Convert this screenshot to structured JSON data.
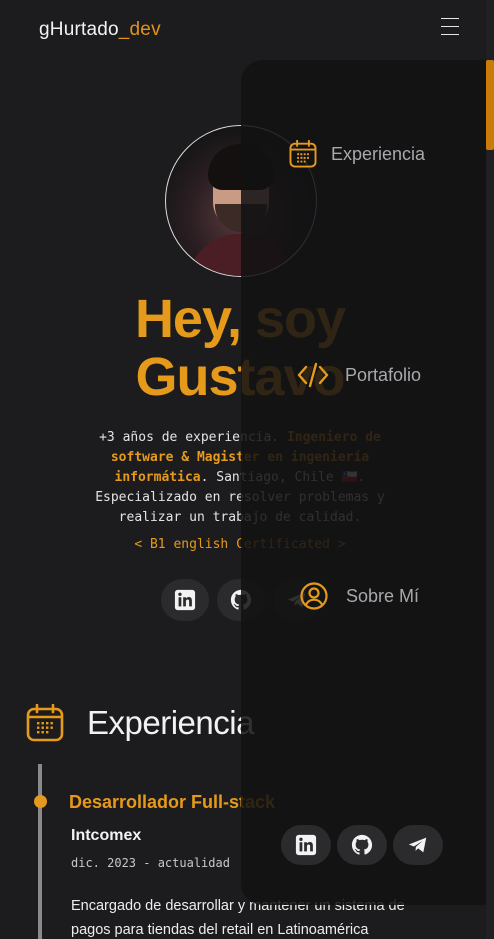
{
  "header": {
    "brand_main": "gHurtado",
    "brand_accent": "_dev",
    "menu_icon": "hamburger-icon"
  },
  "hero": {
    "title_line1": "Hey, soy",
    "title_line2": "Gustavo",
    "desc_part1": "+3 años de experiencia. ",
    "desc_highlight1": "Ingeniero de software & Magister en ingeniería informática",
    "desc_part2": ". Santiago, Chile 🇨🇱. Especializado en resolver problemas y realizar un trabajo de calidad.",
    "certificate": "< B1 english Certificated >",
    "socials": [
      "linkedin-icon",
      "github-icon",
      "telegram-icon"
    ]
  },
  "experience": {
    "section_title": "Experiencia",
    "section_icon": "calendar-icon",
    "jobs": [
      {
        "role": "Desarrollador Full-stack",
        "company": "Intcomex",
        "date": "dic. 2023 - actualidad",
        "description": "Encargado de desarrollar y mantener un sistema de pagos para tiendas del retail en Latinoamérica"
      }
    ]
  },
  "menu": {
    "items": [
      {
        "label": "Experiencia",
        "icon": "calendar-icon"
      },
      {
        "label": "Portafolio",
        "icon": "code-icon"
      },
      {
        "label": "Sobre Mí",
        "icon": "user-circle-icon"
      }
    ],
    "socials": [
      "linkedin-icon",
      "github-icon",
      "telegram-icon"
    ]
  },
  "colors": {
    "accent": "#e69a1c",
    "background": "#1c1c1e",
    "overlay": "#121213"
  }
}
